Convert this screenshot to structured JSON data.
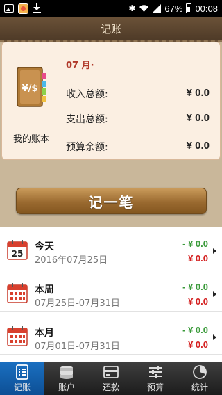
{
  "status_bar": {
    "battery": "67%",
    "time": "00:08",
    "icons": [
      "image-icon",
      "app-icon",
      "download-icon",
      "bluetooth-icon",
      "wifi-icon",
      "signal-icon",
      "battery-icon"
    ]
  },
  "header": {
    "title": "记账"
  },
  "summary": {
    "month": "07 月·",
    "book_label": "我的账本",
    "income_label": "收入总额:",
    "income_value": "¥ 0.0",
    "expense_label": "支出总额:",
    "expense_value": "¥ 0.0",
    "budget_label": "预算余额:",
    "budget_value": "¥ 0.0"
  },
  "record_button": {
    "label": "记一笔"
  },
  "periods": [
    {
      "title": "今天",
      "date_range": "2016年07月25日",
      "calendar_day": "25",
      "income": "- ¥ 0.0",
      "expense": "¥ 0.0"
    },
    {
      "title": "本周",
      "date_range": "07月25日-07月31日",
      "income": "- ¥ 0.0",
      "expense": "¥ 0.0"
    },
    {
      "title": "本月",
      "date_range": "07月01日-07月31日",
      "income": "- ¥ 0.0",
      "expense": "¥ 0.0"
    }
  ],
  "nav": {
    "items": [
      {
        "label": "记账",
        "icon": "list-icon",
        "active": true
      },
      {
        "label": "账户",
        "icon": "coins-icon",
        "active": false
      },
      {
        "label": "还款",
        "icon": "card-icon",
        "active": false
      },
      {
        "label": "预算",
        "icon": "sliders-icon",
        "active": false
      },
      {
        "label": "统计",
        "icon": "pie-chart-icon",
        "active": false
      }
    ]
  },
  "colors": {
    "income": "#3a9a3a",
    "expense": "#d42020",
    "accent": "#0d4f95",
    "leather": "#6b5238"
  }
}
